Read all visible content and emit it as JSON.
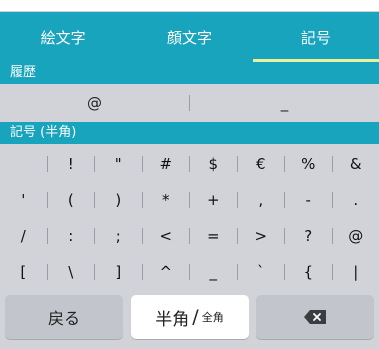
{
  "tabs": [
    {
      "label": "絵文字"
    },
    {
      "label": "顔文字"
    },
    {
      "label": "記号",
      "active": true
    }
  ],
  "history": {
    "header": "履歴",
    "items": [
      "@",
      "_"
    ]
  },
  "symbols": {
    "header": "記号 (半角)",
    "rows": [
      [
        "",
        "!",
        "\"",
        "#",
        "$",
        "€",
        "%",
        "&"
      ],
      [
        "'",
        "(",
        ")",
        "*",
        "+",
        ",",
        "-",
        "."
      ],
      [
        "/",
        ":",
        ";",
        "<",
        "=",
        ">",
        "?",
        "@"
      ],
      [
        "[",
        "\\",
        "]",
        "^",
        "_",
        "`",
        "{",
        "|"
      ]
    ]
  },
  "bottom": {
    "back_label": "戻る",
    "width_toggle": {
      "half": "半角",
      "slash": "/",
      "full": "全角"
    },
    "delete_icon": "backspace-icon"
  },
  "colors": {
    "accent": "#19a4bd",
    "tab_indicator": "#e7f29a",
    "keyboard_bg": "#d1d3d8"
  }
}
